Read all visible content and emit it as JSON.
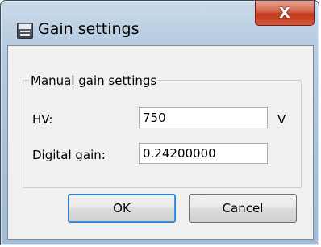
{
  "window": {
    "title": "Gain settings",
    "close_glyph": "X",
    "app_icon": "rsg-app-icon"
  },
  "group": {
    "title": "Manual gain settings"
  },
  "fields": {
    "hv_label": "HV:",
    "hv_value": "750",
    "hv_unit": "V",
    "digital_gain_label": "Digital gain:",
    "digital_gain_value": "0.24200000"
  },
  "buttons": {
    "ok": "OK",
    "cancel": "Cancel"
  }
}
